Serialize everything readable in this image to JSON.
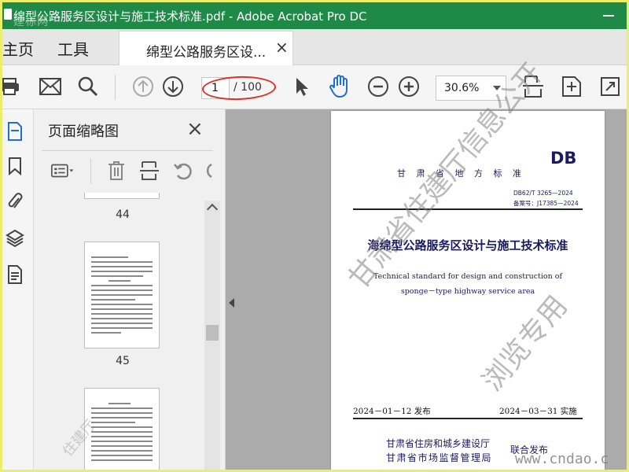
{
  "window": {
    "title": "绵型公路服务区设计与施工技术标准.pdf - Adobe Acrobat Pro DC",
    "overlay_watermark": "建标网"
  },
  "tabs": {
    "home": "主页",
    "tools": "工具",
    "document": "绵型公路服务区设...",
    "document_close": "×"
  },
  "toolbar": {
    "page_current": "1",
    "page_total": "/ 100",
    "zoom": "30.6%"
  },
  "thumbnail_panel": {
    "title": "页面缩略图",
    "close": "×",
    "pages": [
      {
        "number": "44"
      },
      {
        "number": "45"
      }
    ]
  },
  "document_page": {
    "logo": "DB",
    "issuer_region": "甘 肃 省 地 方 标 准",
    "code": "DB62/T 3265—2024",
    "record": "备案号：J17385—2024",
    "title_cn": "海绵型公路服务区设计与施工技术标准",
    "title_en_1": "Technical standard for design and construction of",
    "title_en_2": "sponge－type highway service area",
    "release_date": "2024－01－12 发布",
    "implement_date": "2024－03－31 实施",
    "issuer_1": "甘肃省住房和城乡建设厅",
    "issuer_2": "甘肃省市场监督管理局",
    "joint": "联合发布"
  },
  "watermarks": {
    "main": "甘肃省住建厅信息公开",
    "view": "浏览专用",
    "site": "www.cndao.c",
    "thumb": "住建厅"
  },
  "colors": {
    "titlebar": "#1f8a47",
    "highlight_ellipse": "#d9322b",
    "accent_blue": "#1f6fd1"
  }
}
